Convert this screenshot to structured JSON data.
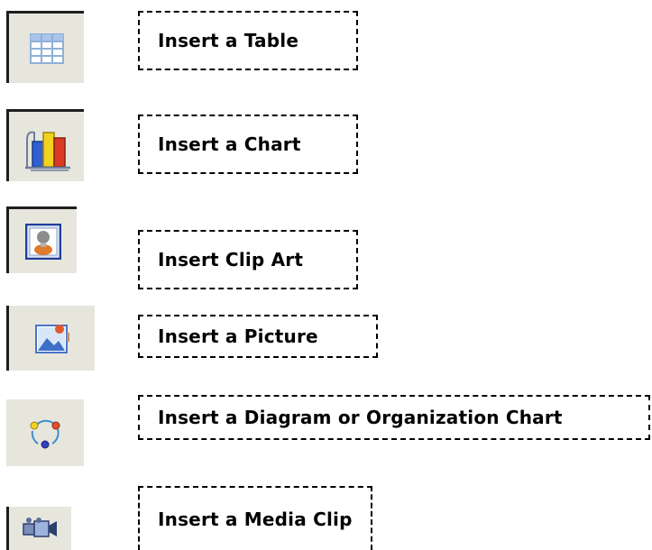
{
  "items": [
    {
      "label": "Insert a Table",
      "icon": "table-icon"
    },
    {
      "label": "Insert a Chart",
      "icon": "chart-icon"
    },
    {
      "label": "Insert Clip Art",
      "icon": "clip-art-icon"
    },
    {
      "label": "Insert a Picture",
      "icon": "picture-icon"
    },
    {
      "label": "Insert a Diagram or Organization Chart",
      "icon": "diagram-icon"
    },
    {
      "label": "Insert a Media Clip",
      "icon": "media-clip-icon"
    }
  ],
  "colors": {
    "tile_background": "#e7e6dd",
    "tile_border": "#1e1e1e",
    "box_border": "#000000",
    "text": "#000000"
  }
}
